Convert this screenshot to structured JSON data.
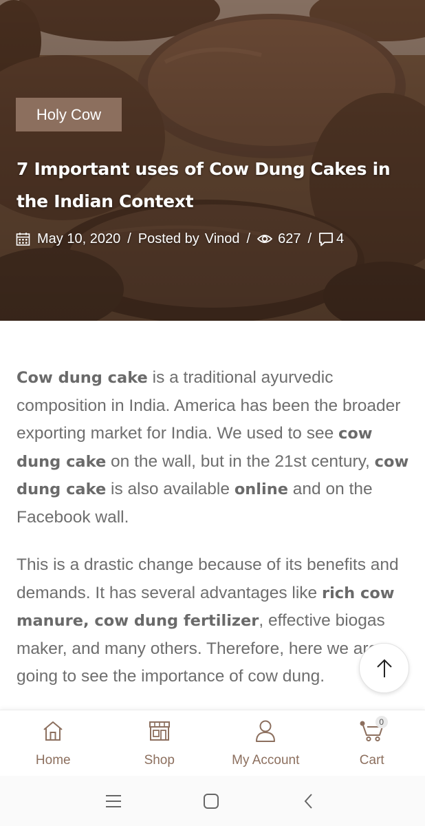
{
  "hero": {
    "category": "Holy Cow",
    "title": "7 Important uses of Cow Dung Cakes in the Indian Context",
    "meta": {
      "date": "May 10, 2020",
      "posted_by_label": "Posted by",
      "author": "Vinod",
      "views": "627",
      "comments": "4",
      "separator": "/"
    }
  },
  "article": {
    "p1": {
      "s1": "Cow dung cake",
      "t1": " is a traditional ayurvedic composition in India. America has been the broader exporting market for India. We used to see ",
      "s2": "cow dung cake",
      "t2": " on the wall, but in the 21st century, ",
      "s3": "cow dung cake",
      "t3": " is also available ",
      "s4": "online",
      "t4": " and on the Facebook wall."
    },
    "p2": {
      "t1": "This is a drastic change because of its benefits and demands. It has several advantages like ",
      "s1": "rich cow manure, cow dung fertilizer",
      "t2": ", effective biogas maker, and many others. Therefore, here we are going to see the importance of cow dung."
    }
  },
  "bottom_nav": {
    "items": [
      {
        "label": "Home",
        "icon": "home-icon"
      },
      {
        "label": "Shop",
        "icon": "shop-icon"
      },
      {
        "label": "My Account",
        "icon": "user-icon"
      },
      {
        "label": "Cart",
        "icon": "cart-icon"
      }
    ],
    "cart_count": "0"
  },
  "system_nav": {
    "icons": [
      "recent-apps-icon",
      "home-button-icon",
      "back-icon"
    ]
  },
  "colors": {
    "accent": "#8c6f5e",
    "text": "#6e6e6e",
    "hero_bg": "#5a3f2c"
  }
}
